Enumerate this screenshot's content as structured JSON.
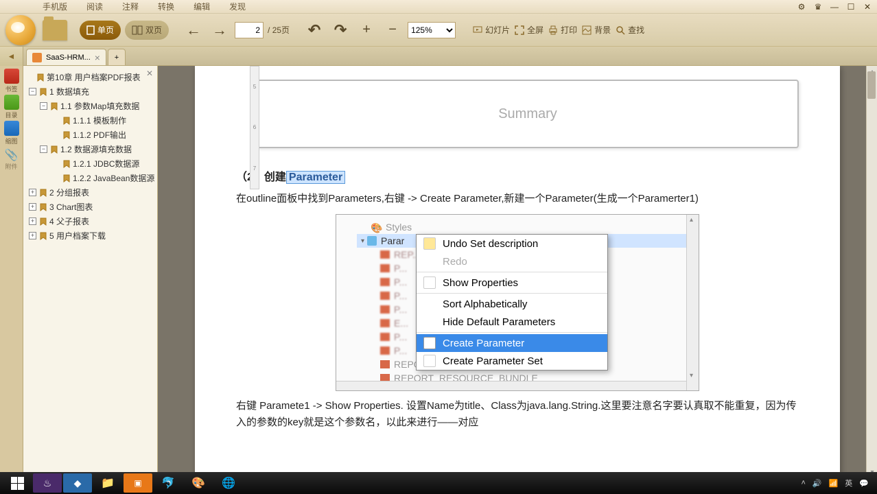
{
  "menu": {
    "mobile": "手机版",
    "read": "阅读",
    "annotate": "注释",
    "convert": "转换",
    "edit": "编辑",
    "discover": "发现"
  },
  "toolbar": {
    "single_page": "单页",
    "dual_page": "双页",
    "page_input": "2",
    "page_total": "/ 25页",
    "zoom": "125%",
    "slideshow": "幻灯片",
    "fullscreen": "全屏",
    "print": "打印",
    "background": "背景",
    "search": "查找"
  },
  "tab": {
    "title": "SaaS-HRM...",
    "collapse": "◄"
  },
  "sidebar_icons": {
    "i1": "书签",
    "i2": "目录",
    "i3": "缩图",
    "i4": "附件"
  },
  "outline": {
    "root": "第10章 用户档案PDF报表",
    "n1": "1 数据填充",
    "n11": "1.1 参数Map填充数据",
    "n111": "1.1.1 模板制作",
    "n112": "1.1.2 PDF输出",
    "n12": "1.2 数据源填充数据",
    "n121": "1.2.1 JDBC数据源",
    "n122": "1.2.2 JavaBean数据源",
    "n2": "2 分组报表",
    "n3": "3 Chart图表",
    "n4": "4 父子报表",
    "n5": "5 用户档案下载"
  },
  "doc": {
    "summary_label": "Summary",
    "heading_prefix": "（2）创建",
    "heading_hl": "Parameter",
    "para1": "在outline面板中找到Parameters,右键 -> Create Parameter,新建一个Parameter(生成一个Paramerter1)",
    "para2": "右键 Paramete1 -> Show Properties. 设置Name为title、Class为java.lang.String.这里要注意名字要认真取不能重复，因为传入的参数的key就是这个参数名，以此来进行——对应",
    "tree": {
      "styles": "Styles",
      "param": "Parar",
      "items_blur": "REPORT_LOCALE",
      "items_blur2": "REPORT_RESOURCE_BUNDLE"
    },
    "ctx": {
      "undo": "Undo Set description",
      "redo": "Redo",
      "showprop": "Show Properties",
      "sort": "Sort Alphabetically",
      "hide": "Hide Default Parameters",
      "create": "Create Parameter",
      "createset": "Create Parameter Set"
    }
  },
  "tray": {
    "ime": "英",
    "time_hint": ""
  }
}
